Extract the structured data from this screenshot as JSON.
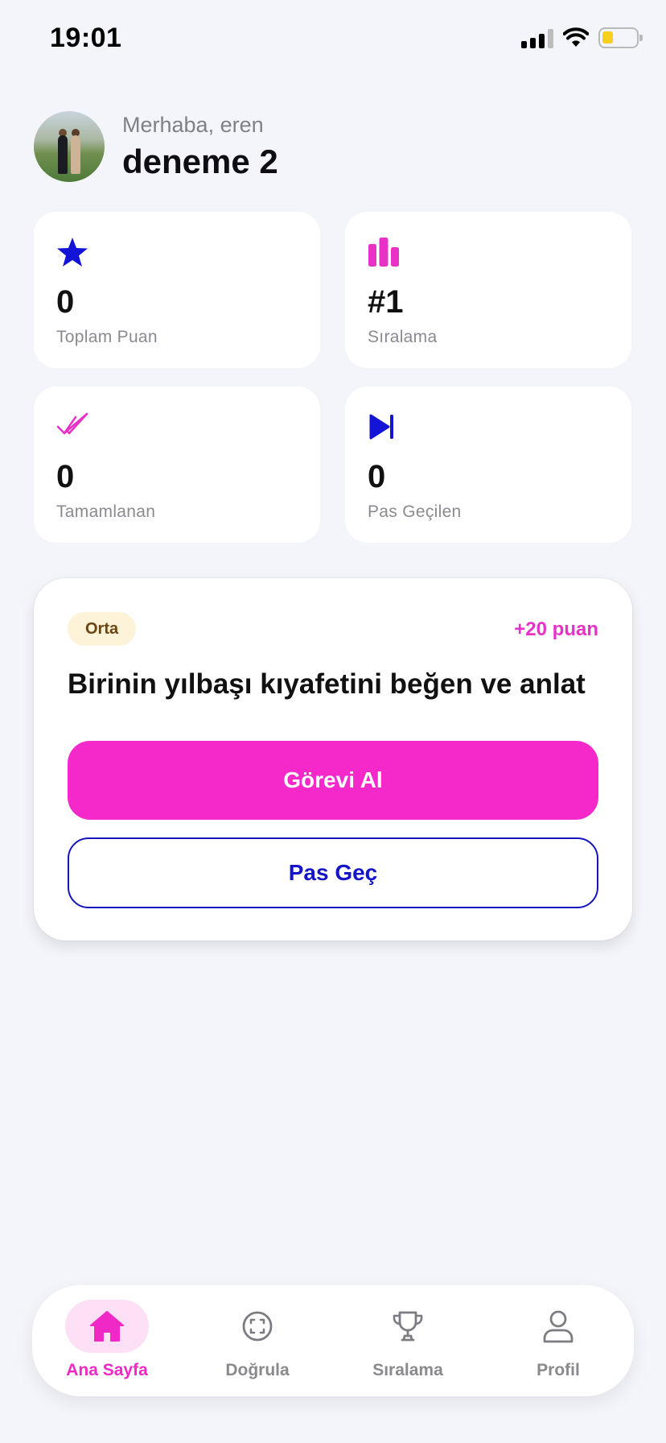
{
  "status_bar": {
    "time": "19:01",
    "icons": [
      "cellular-signal-icon",
      "wifi-icon",
      "battery-low-icon"
    ]
  },
  "header": {
    "greeting": "Merhaba, eren",
    "user_name": "deneme 2"
  },
  "stats": [
    {
      "icon": "star-icon",
      "value": "0",
      "label": "Toplam Puan",
      "color": "#1414d6"
    },
    {
      "icon": "bar-chart-icon",
      "value": "#1",
      "label": "Sıralama",
      "color": "#e832c7"
    },
    {
      "icon": "double-check-icon",
      "value": "0",
      "label": "Tamamlanan",
      "color": "#e832c7"
    },
    {
      "icon": "skip-forward-icon",
      "value": "0",
      "label": "Pas Geçilen",
      "color": "#1414d6"
    }
  ],
  "task": {
    "difficulty": "Orta",
    "points": "+20 puan",
    "title": "Birinin yılbaşı kıyafetini beğen ve anlat",
    "take_label": "Görevi Al",
    "skip_label": "Pas Geç"
  },
  "nav": {
    "items": [
      {
        "icon": "home-icon",
        "label": "Ana Sayfa",
        "active": true
      },
      {
        "icon": "scan-face-icon",
        "label": "Doğrula",
        "active": false
      },
      {
        "icon": "trophy-icon",
        "label": "Sıralama",
        "active": false
      },
      {
        "icon": "user-icon",
        "label": "Profil",
        "active": false
      }
    ]
  },
  "colors": {
    "accent_pink": "#f529c9",
    "accent_blue": "#1414c8",
    "background": "#f4f5fa",
    "battery_level": "#f8cf1c"
  }
}
